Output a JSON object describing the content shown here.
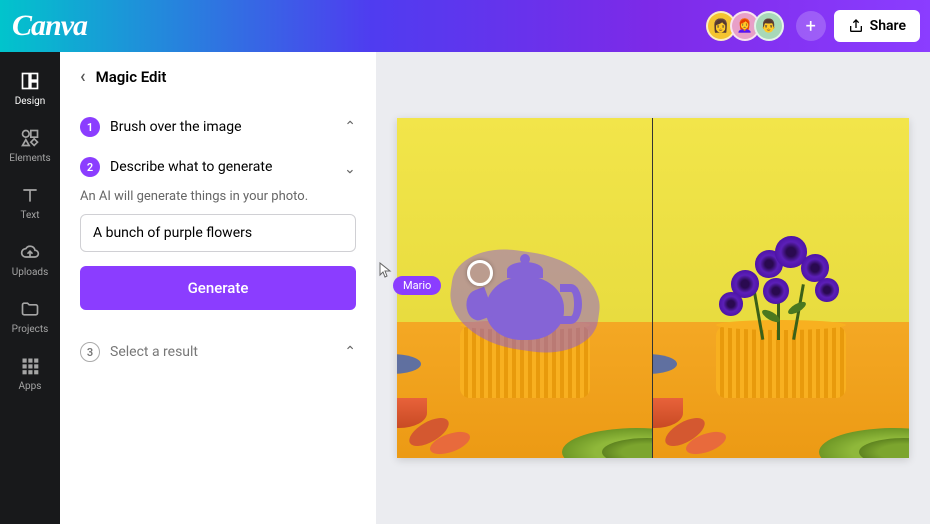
{
  "brand": "Canva",
  "topbar": {
    "share_label": "Share",
    "avatars": [
      "👩",
      "👩‍🦰",
      "👨"
    ],
    "plus_icon": "+"
  },
  "leftnav": {
    "items": [
      {
        "id": "design",
        "label": "Design"
      },
      {
        "id": "elements",
        "label": "Elements"
      },
      {
        "id": "text",
        "label": "Text"
      },
      {
        "id": "uploads",
        "label": "Uploads"
      },
      {
        "id": "projects",
        "label": "Projects"
      },
      {
        "id": "apps",
        "label": "Apps"
      }
    ]
  },
  "sidebar": {
    "title": "Magic Edit",
    "steps": [
      {
        "num": "1",
        "label": "Brush over the image",
        "active": true,
        "expanded": false
      },
      {
        "num": "2",
        "label": "Describe what to generate",
        "active": true,
        "expanded": true
      },
      {
        "num": "3",
        "label": "Select a result",
        "active": false,
        "expanded": false
      }
    ],
    "step2_desc": "An AI will generate things in your photo.",
    "prompt_value": "A bunch of purple flowers",
    "prompt_placeholder": "",
    "generate_label": "Generate",
    "cursor_tag": "Mario"
  },
  "colors": {
    "accent": "#8b3dff"
  }
}
